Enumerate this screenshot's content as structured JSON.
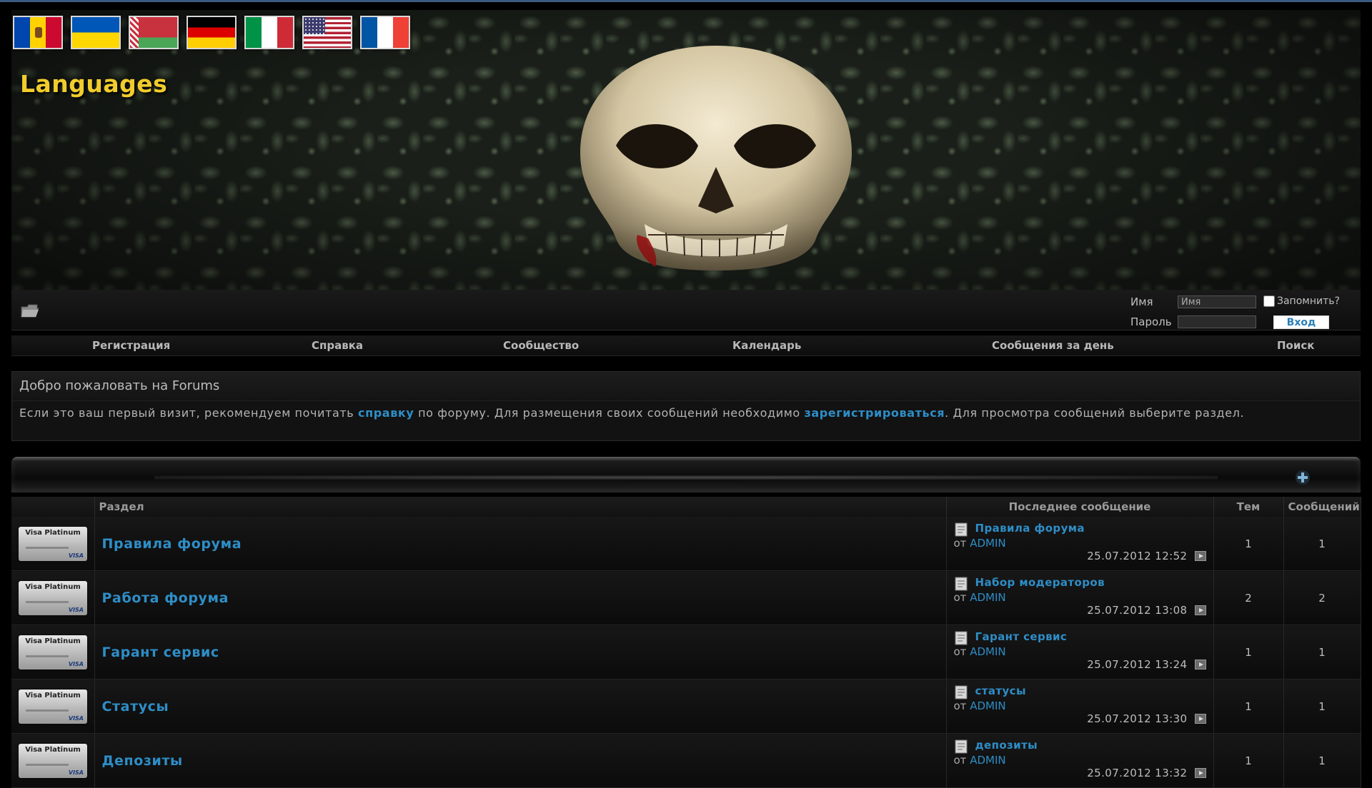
{
  "banner": {
    "title": "Languages",
    "flags": [
      "flag-moldova-icon",
      "flag-ukraine-icon",
      "flag-belarus-icon",
      "flag-germany-icon",
      "flag-italy-icon",
      "flag-usa-icon",
      "flag-france-icon"
    ]
  },
  "login": {
    "name_label": "Имя",
    "name_value": "Имя",
    "remember_label": "Запомнить?",
    "password_label": "Пароль",
    "submit_label": "Вход"
  },
  "menu": {
    "register": "Регистрация",
    "help": "Справка",
    "community": "Сообщество",
    "calendar": "Календарь",
    "today_posts": "Сообщения за день",
    "search": "Поиск"
  },
  "welcome": {
    "title": "Добро пожаловать на Forums",
    "text_1": "Если это ваш первый визит, рекомендуем почитать ",
    "help_link": "справку",
    "text_2": " по форуму. Для размещения своих сообщений необходимо ",
    "register_link": "зарегистрироваться",
    "text_3": ". Для просмотра сообщений выберите раздел."
  },
  "table": {
    "headers": {
      "section": "Раздел",
      "last_post": "Последнее сообщение",
      "topics": "Тем",
      "posts": "Сообщений"
    },
    "card_label": "Visa Platinum",
    "card_brand": "VISA",
    "by_label": "от",
    "rows": [
      {
        "title": "Правила форума",
        "last_title": "Правила форума",
        "author": "ADMIN",
        "date": "25.07.2012 12:52",
        "topics": "1",
        "posts": "1"
      },
      {
        "title": "Работа форума",
        "last_title": "Набор модераторов",
        "author": "ADMIN",
        "date": "25.07.2012 13:08",
        "topics": "2",
        "posts": "2"
      },
      {
        "title": "Гарант сервис",
        "last_title": "Гарант сервис",
        "author": "ADMIN",
        "date": "25.07.2012 13:24",
        "topics": "1",
        "posts": "1"
      },
      {
        "title": "Статусы",
        "last_title": "статусы",
        "author": "ADMIN",
        "date": "25.07.2012 13:30",
        "topics": "1",
        "posts": "1"
      },
      {
        "title": "Депозиты",
        "last_title": "депозиты",
        "author": "ADMIN",
        "date": "25.07.2012 13:32",
        "topics": "1",
        "posts": "1"
      }
    ]
  },
  "colors": {
    "link": "#2e8ec7",
    "title_yellow": "#f1cc2c",
    "background": "#000000"
  }
}
